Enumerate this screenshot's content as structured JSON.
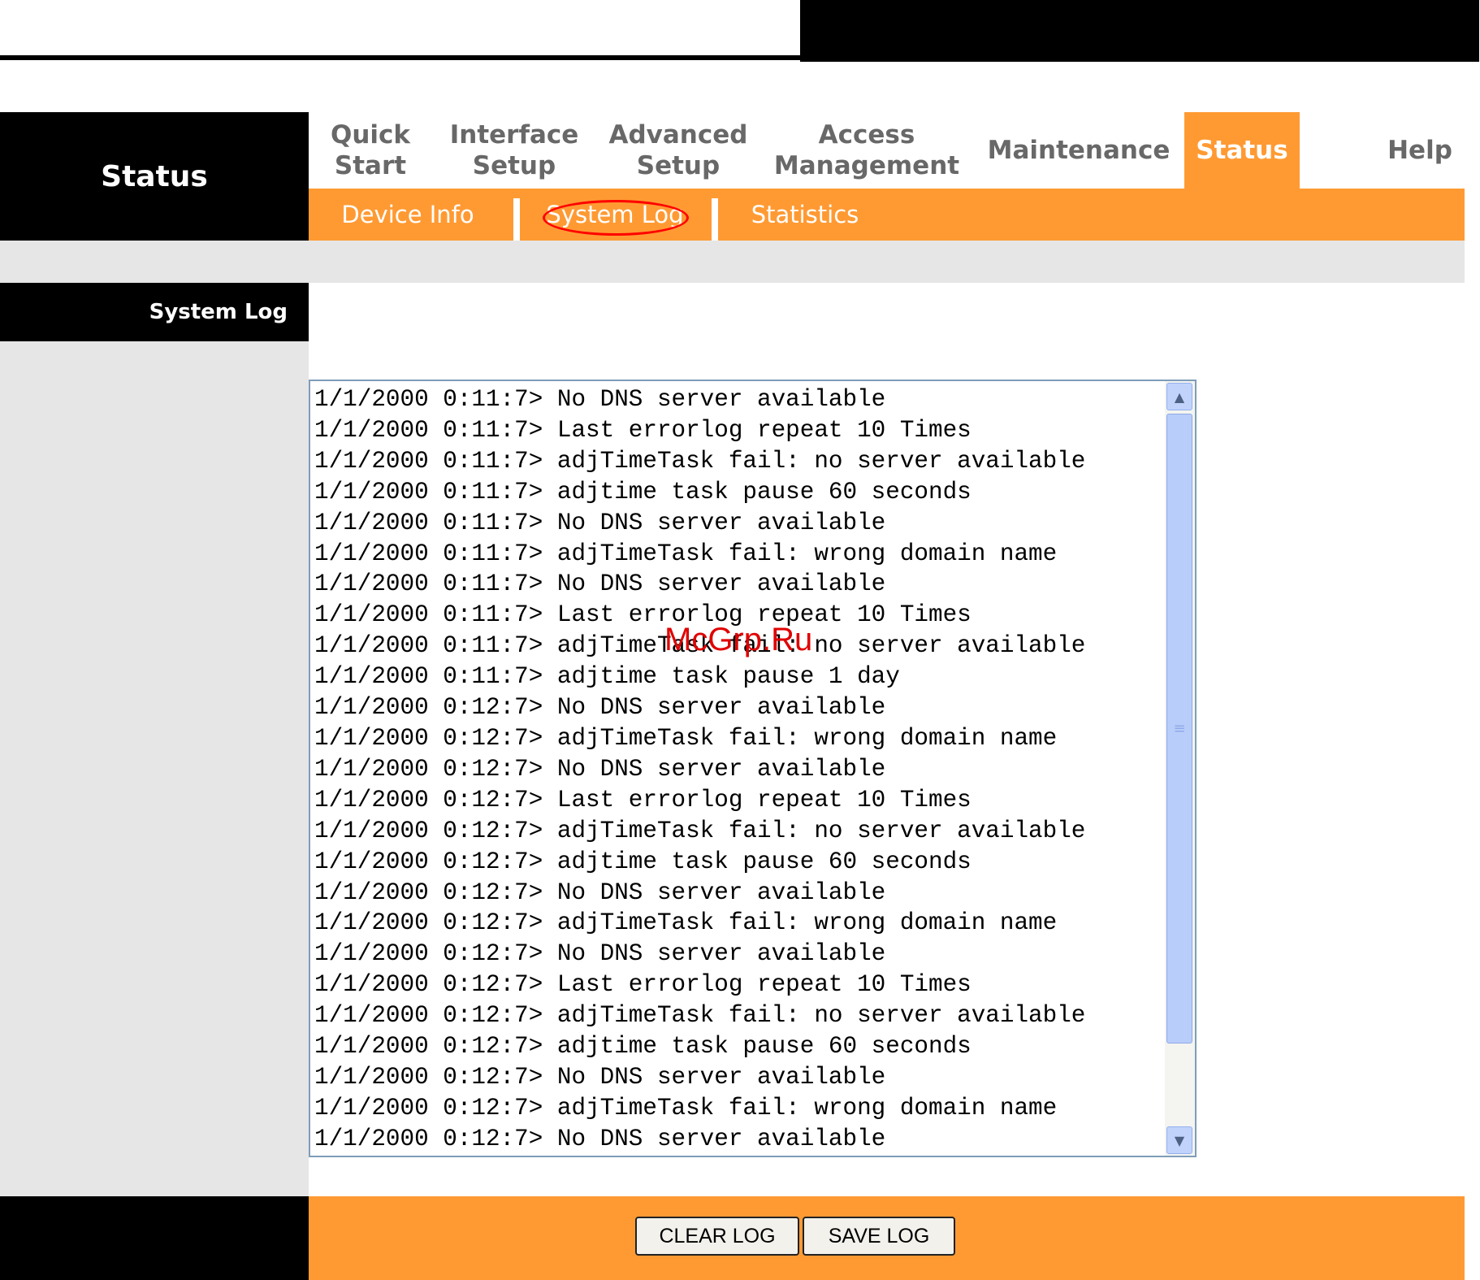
{
  "header": {
    "section_title": "Status"
  },
  "menu": {
    "items": [
      {
        "label": "Quick\nStart"
      },
      {
        "label": "Interface\nSetup"
      },
      {
        "label": "Advanced\nSetup"
      },
      {
        "label": "Access\nManagement"
      },
      {
        "label": "Maintenance"
      },
      {
        "label": "Status",
        "active": true
      },
      {
        "label": "Help"
      }
    ]
  },
  "submenu": {
    "items": [
      {
        "label": "Device Info"
      },
      {
        "label": "System Log",
        "active": true
      },
      {
        "label": "Statistics"
      }
    ]
  },
  "page": {
    "section_label": "System Log"
  },
  "log": {
    "lines": [
      "1/1/2000 0:11:7> No DNS server available",
      "1/1/2000 0:11:7> Last errorlog repeat 10 Times",
      "1/1/2000 0:11:7> adjTimeTask fail: no server available",
      "1/1/2000 0:11:7> adjtime task pause 60 seconds",
      "1/1/2000 0:11:7> No DNS server available",
      "1/1/2000 0:11:7> adjTimeTask fail: wrong domain name",
      "1/1/2000 0:11:7> No DNS server available",
      "1/1/2000 0:11:7> Last errorlog repeat 10 Times",
      "1/1/2000 0:11:7> adjTimeTask fail: no server available",
      "1/1/2000 0:11:7> adjtime task pause 1 day",
      "1/1/2000 0:12:7> No DNS server available",
      "1/1/2000 0:12:7> adjTimeTask fail: wrong domain name",
      "1/1/2000 0:12:7> No DNS server available",
      "1/1/2000 0:12:7> Last errorlog repeat 10 Times",
      "1/1/2000 0:12:7> adjTimeTask fail: no server available",
      "1/1/2000 0:12:7> adjtime task pause 60 seconds",
      "1/1/2000 0:12:7> No DNS server available",
      "1/1/2000 0:12:7> adjTimeTask fail: wrong domain name",
      "1/1/2000 0:12:7> No DNS server available",
      "1/1/2000 0:12:7> Last errorlog repeat 10 Times",
      "1/1/2000 0:12:7> adjTimeTask fail: no server available",
      "1/1/2000 0:12:7> adjtime task pause 60 seconds",
      "1/1/2000 0:12:7> No DNS server available",
      "1/1/2000 0:12:7> adjTimeTask fail: wrong domain name",
      "1/1/2000 0:12:7> No DNS server available"
    ]
  },
  "buttons": {
    "clear_log": "CLEAR LOG",
    "save_log": "SAVE LOG"
  },
  "watermark": "McGrp.Ru",
  "colors": {
    "accent": "#FF9A33",
    "panel_gray": "#E6E6E6",
    "highlight_red": "#FF0000"
  },
  "icons": {
    "scroll_up": "chevron-up-icon",
    "scroll_down": "chevron-down-icon"
  }
}
